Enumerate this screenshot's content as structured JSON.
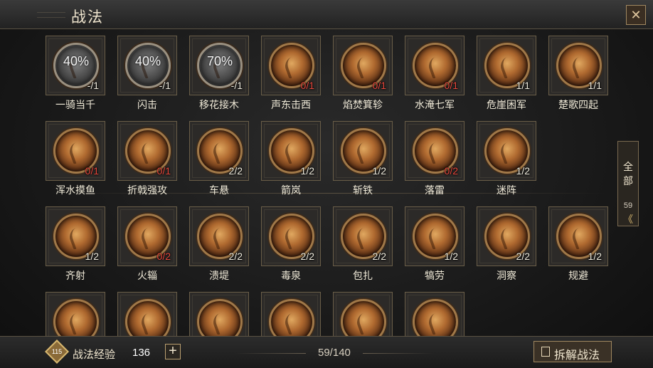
{
  "header": {
    "title": "战法",
    "close_icon": "close-icon"
  },
  "cards": [
    {
      "name": "一骑当千",
      "count": "-/1",
      "percent": "40%",
      "grey": true,
      "red": false
    },
    {
      "name": "闪击",
      "count": "-/1",
      "percent": "40%",
      "grey": true,
      "red": false
    },
    {
      "name": "移花接木",
      "count": "-/1",
      "percent": "70%",
      "grey": true,
      "red": false
    },
    {
      "name": "声东击西",
      "count": "0/1",
      "percent": "",
      "grey": false,
      "red": true
    },
    {
      "name": "焰焚箕轸",
      "count": "0/1",
      "percent": "",
      "grey": false,
      "red": true
    },
    {
      "name": "水淹七军",
      "count": "0/1",
      "percent": "",
      "grey": false,
      "red": true
    },
    {
      "name": "危崖困军",
      "count": "1/1",
      "percent": "",
      "grey": false,
      "red": false
    },
    {
      "name": "楚歌四起",
      "count": "1/1",
      "percent": "",
      "grey": false,
      "red": false
    },
    {
      "name": "浑水摸鱼",
      "count": "0/1",
      "percent": "",
      "grey": false,
      "red": true
    },
    {
      "name": "折戟强攻",
      "count": "0/1",
      "percent": "",
      "grey": false,
      "red": true
    },
    {
      "name": "车悬",
      "count": "2/2",
      "percent": "",
      "grey": false,
      "red": false
    },
    {
      "name": "箭岚",
      "count": "1/2",
      "percent": "",
      "grey": false,
      "red": false
    },
    {
      "name": "斩铁",
      "count": "1/2",
      "percent": "",
      "grey": false,
      "red": false
    },
    {
      "name": "落雷",
      "count": "0/2",
      "percent": "",
      "grey": false,
      "red": true
    },
    {
      "name": "迷阵",
      "count": "1/2",
      "percent": "",
      "grey": false,
      "red": false
    },
    {
      "name": "齐射",
      "count": "1/2",
      "percent": "",
      "grey": false,
      "red": false
    },
    {
      "name": "火辎",
      "count": "0/2",
      "percent": "",
      "grey": false,
      "red": true
    },
    {
      "name": "溃堤",
      "count": "2/2",
      "percent": "",
      "grey": false,
      "red": false
    },
    {
      "name": "毒泉",
      "count": "2/2",
      "percent": "",
      "grey": false,
      "red": false
    },
    {
      "name": "包扎",
      "count": "2/2",
      "percent": "",
      "grey": false,
      "red": false
    },
    {
      "name": "犒劳",
      "count": "1/2",
      "percent": "",
      "grey": false,
      "red": false
    },
    {
      "name": "洞察",
      "count": "2/2",
      "percent": "",
      "grey": false,
      "red": false
    },
    {
      "name": "规避",
      "count": "1/2",
      "percent": "",
      "grey": false,
      "red": false
    },
    {
      "name": "",
      "count": "",
      "percent": "",
      "grey": false,
      "red": false
    },
    {
      "name": "",
      "count": "",
      "percent": "",
      "grey": false,
      "red": false
    },
    {
      "name": "",
      "count": "",
      "percent": "",
      "grey": false,
      "red": false
    },
    {
      "name": "",
      "count": "",
      "percent": "",
      "grey": false,
      "red": false
    },
    {
      "name": "",
      "count": "",
      "percent": "",
      "grey": false,
      "red": false
    },
    {
      "name": "",
      "count": "",
      "percent": "",
      "grey": false,
      "red": false
    }
  ],
  "side_tab": {
    "label_1": "全",
    "label_2": "部",
    "count": "59",
    "arrow": "《"
  },
  "footer": {
    "level_badge": "115",
    "exp_label": "战法经验",
    "exp_value": "136",
    "plus": "+",
    "collection": "59/140",
    "dismantle_label": "拆解战法"
  },
  "colors": {
    "accent_gold": "#a08860",
    "count_red": "#e8483c"
  }
}
